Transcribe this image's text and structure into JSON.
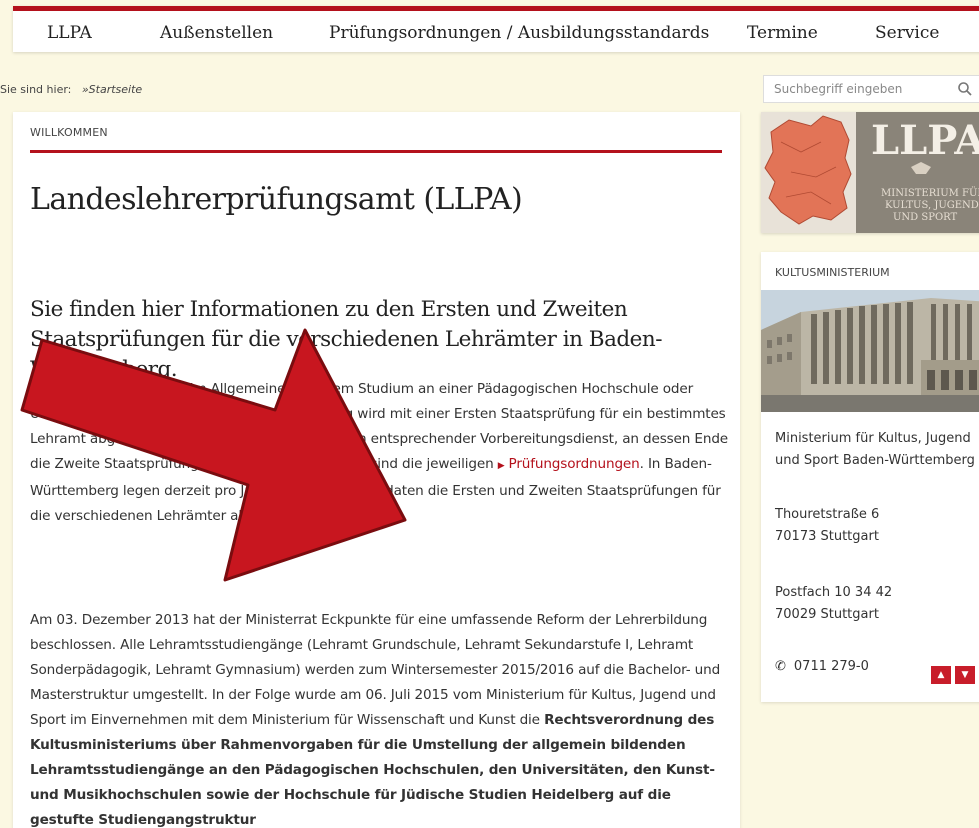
{
  "nav": {
    "items": [
      "LLPA",
      "Außenstellen",
      "Prüfungsordnungen / Ausbildungsstandards",
      "Termine",
      "Service"
    ]
  },
  "breadcrumb": {
    "prefix": "Sie sind hier:",
    "current": "»Startseite"
  },
  "main": {
    "section_label": "WILLKOMMEN",
    "title": "Landeslehrerprüfungsamt (LLPA)",
    "subtitle": "Sie finden hier Informationen zu den Ersten und Zweiten Staatsprüfungen für die verschiedenen Lehrämter in Baden-Württemberg.",
    "para1": {
      "part1": "Die Ausbildung beginnt im Allgemeinen mit dem Studium an einer Pädagogischen Hochschule oder Universität. Diese erste Phase der Lehrerbildung wird mit einer Ersten Staatsprüfung für ein bestimmtes Lehramt abgeschlossen. Als zweite Phase folgt ein entsprechender Vorbereitungsdienst, an dessen Ende die Zweite Staatsprüfung steht. Rechtsgrundlagen sind die jeweiligen ",
      "link": "Prüfungsordnungen",
      "part2": ". In Baden-Württemberg legen derzeit pro Jahr rund 5.000 Kandidaten die Ersten und Zweiten Staatsprüfungen für die verschiedenen Lehrämter ab."
    },
    "para2": {
      "part1": "Am 03. Dezember 2013 hat der Ministerrat Eckpunkte für eine umfassende Reform der Lehrerbildung beschlossen. Alle Lehramtsstudiengänge (Lehramt Grundschule, Lehramt Sekundarstufe I, Lehramt Sonderpädagogik, Lehramt Gymnasium) werden zum Wintersemester 2015/2016 auf die Bachelor- und Masterstruktur umgestellt. In der Folge wurde am 06. Juli 2015 vom Ministerium für Kultus, Jugend und Sport im Einvernehmen mit dem Ministerium für Wissenschaft und Kunst die ",
      "bold": "Rechtsverordnung des Kultusministeriums über Rahmenvorgaben für die Umstellung der allgemein bildenden Lehramtsstudiengänge an den Pädagogischen Hochschulen, den Universitäten, den Kunst- und Musikhochschulen sowie der Hochschule für Jüdische Studien Heidelberg auf die gestufte Studiengangstruktur"
    }
  },
  "search": {
    "placeholder": "Suchbegriff eingeben"
  },
  "sidebar": {
    "logo_text": "LLPA",
    "logo_sub": [
      "MINISTERIUM FÜR",
      "KULTUS, JUGEND",
      "UND SPORT"
    ],
    "ministry_title": "KULTUSMINISTERIUM",
    "ministry_name": "Ministerium für Kultus, Jugend und Sport Baden-Württemberg",
    "street": [
      "Thouretstraße 6",
      "70173 Stuttgart"
    ],
    "postbox": [
      "Postfach 10 34 42",
      "70029 Stuttgart"
    ],
    "phone": "0711 279-0"
  },
  "colors": {
    "accent": "#b4111c",
    "background": "#fbf8e2",
    "arrow": "#c8161f"
  },
  "icons": {
    "search": "magnifier-icon",
    "phone": "phone-icon",
    "scroll_up": "caret-up-icon",
    "scroll_down": "caret-down-icon"
  }
}
